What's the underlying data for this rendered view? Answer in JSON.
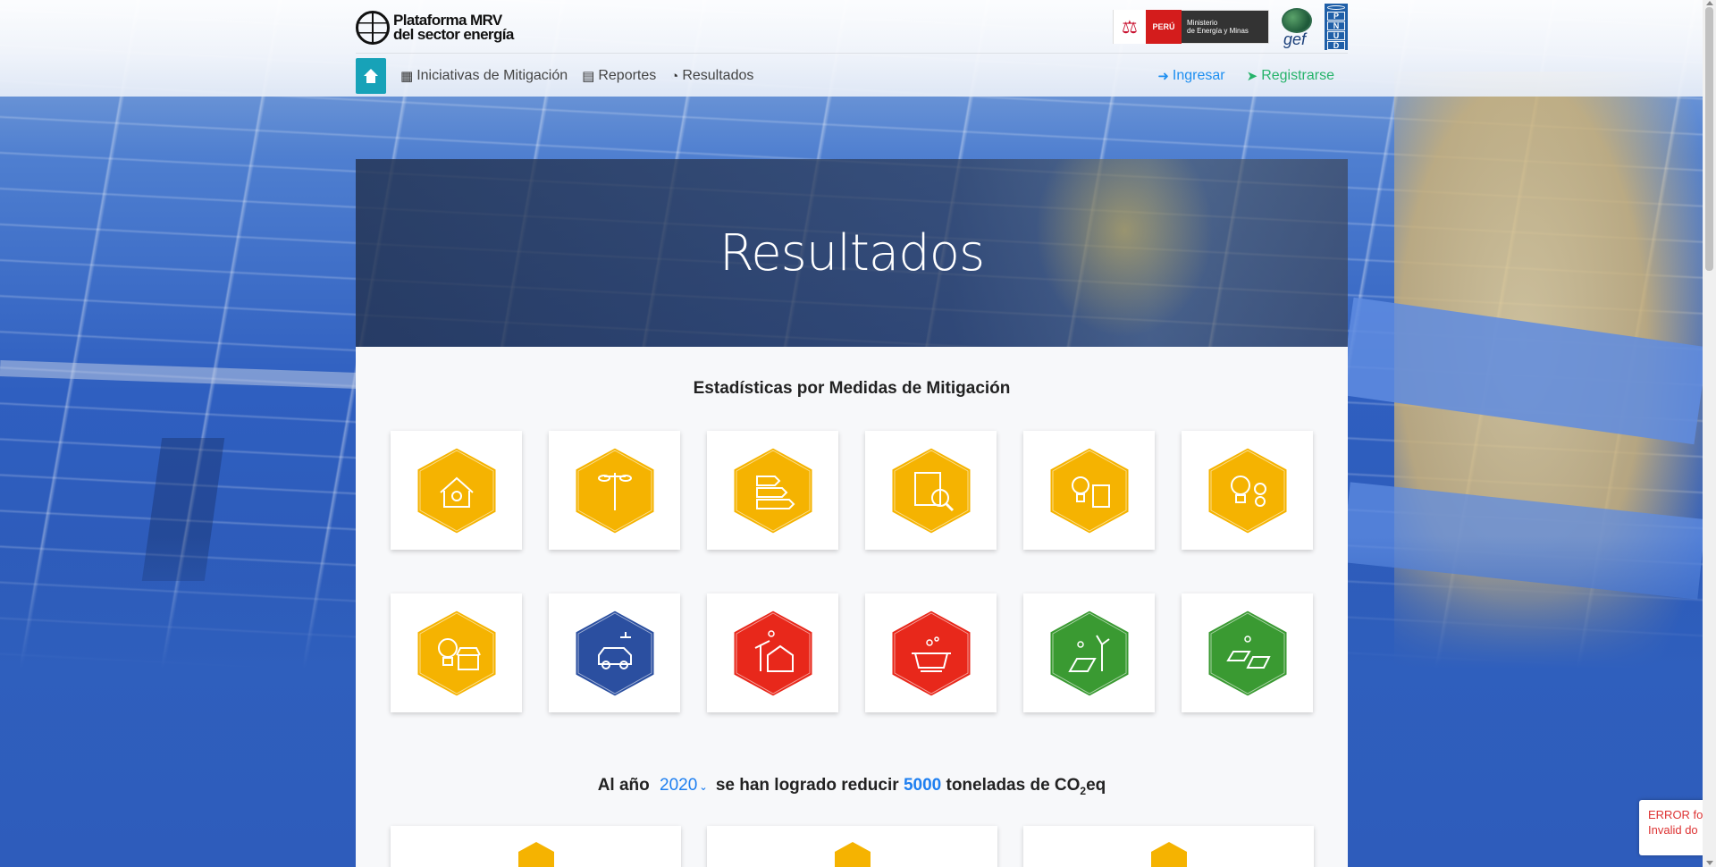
{
  "brand": {
    "line1": "Plataforma MRV",
    "line2": "del sector energía"
  },
  "logos": {
    "minem_peru": "PERÚ",
    "minem_text_1": "Ministerio",
    "minem_text_2": "de Energía y Minas",
    "gef": "gef",
    "pnud": [
      "P",
      "N",
      "U",
      "D"
    ]
  },
  "nav": {
    "home_icon": "home-icon",
    "items": [
      {
        "label": "Iniciativas de Mitigación",
        "icon": "solar-panel-icon"
      },
      {
        "label": "Reportes",
        "icon": "document-icon"
      },
      {
        "label": "Resultados",
        "icon": "pie-chart-icon"
      }
    ],
    "login": "Ingresar",
    "register": "Registrarse"
  },
  "hero": {
    "title": "Resultados"
  },
  "section": {
    "title": "Estadísticas por Medidas de Mitigación"
  },
  "measures": [
    {
      "icon": "house-lightbulb-icon",
      "color": "#f5b301"
    },
    {
      "icon": "street-lamp-icon",
      "color": "#f5b301"
    },
    {
      "icon": "energy-label-icon",
      "color": "#f5b301"
    },
    {
      "icon": "energy-audit-icon",
      "color": "#f5b301"
    },
    {
      "icon": "lightbulb-building-icon",
      "color": "#f5b301"
    },
    {
      "icon": "lightbulb-gears-icon",
      "color": "#f5b301"
    },
    {
      "icon": "lightbulb-shop-icon",
      "color": "#f5b301"
    },
    {
      "icon": "electric-car-icon",
      "color": "#2b4fa0"
    },
    {
      "icon": "rural-solar-house-icon",
      "color": "#e8281b"
    },
    {
      "icon": "cooking-pot-icon",
      "color": "#e8281b"
    },
    {
      "icon": "solar-wind-icon",
      "color": "#3a9a32"
    },
    {
      "icon": "solar-farm-icon",
      "color": "#3a9a32"
    }
  ],
  "summary": {
    "prefix": "Al año",
    "year": "2020",
    "middle": "se han logrado reducir",
    "amount": "5000",
    "suffix": "toneladas de CO",
    "subscript": "2",
    "suffix2": "eq"
  },
  "recaptcha": {
    "line1": "ERROR fo",
    "line2": "Invalid do"
  }
}
